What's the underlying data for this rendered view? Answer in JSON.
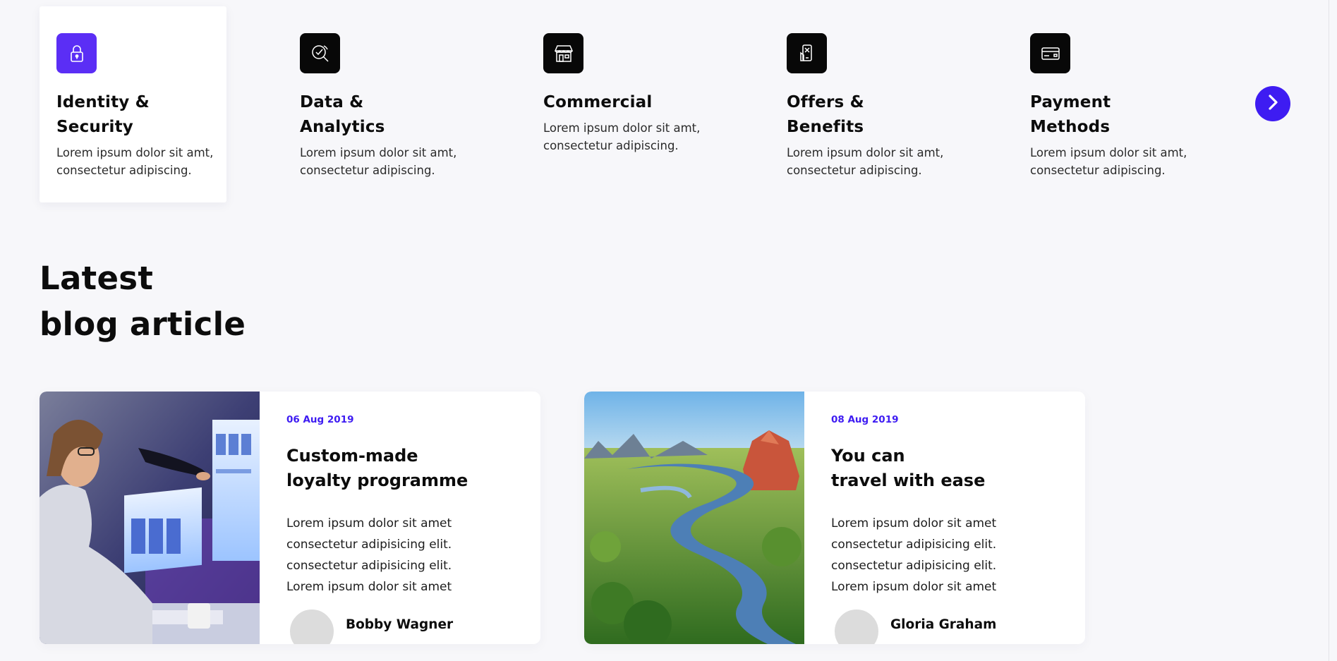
{
  "colors": {
    "accent": "#5b2ef5",
    "brand_blue": "#3e1cf2",
    "icon_bg": "#080808",
    "page_bg": "#f7f7fa"
  },
  "features": [
    {
      "title": "Identity &\nSecurity",
      "desc": "Lorem ipsum dolor sit amt, consectetur adipiscing.",
      "icon": "lock-icon",
      "active": true
    },
    {
      "title": "Data &\nAnalytics",
      "desc": "Lorem ipsum dolor sit amt, consectetur adipiscing.",
      "icon": "analytics-search-icon",
      "active": false
    },
    {
      "title": "Commercial",
      "desc": "Lorem ipsum dolor sit amt, consectetur adipiscing.",
      "icon": "store-icon",
      "active": false
    },
    {
      "title": "Offers &\nBenefits",
      "desc": "Lorem ipsum dolor sit amt, consectetur adipiscing.",
      "icon": "mobile-offer-icon",
      "active": false
    },
    {
      "title": "Payment\nMethods",
      "desc": "Lorem ipsum dolor sit amt, consectetur adipiscing.",
      "icon": "credit-card-icon",
      "active": false
    }
  ],
  "carousel": {
    "next_icon": "chevron-right-icon"
  },
  "blog": {
    "heading_line1": "Latest",
    "heading_line2": "blog article",
    "articles": [
      {
        "date": "06 Aug 2019",
        "title": "Custom-made\nloyalty programme",
        "text": "Lorem ipsum dolor sit amet\nconsectetur adipisicing elit.\nconsectetur adipisicing elit.\nLorem ipsum dolor sit amet",
        "author": "Bobby Wagner",
        "image": "woman-at-computer-photo"
      },
      {
        "date": "08 Aug 2019",
        "title": "You can\ntravel with ease",
        "text": "Lorem ipsum dolor sit amet\nconsectetur adipisicing elit.\nconsectetur adipisicing elit.\nLorem ipsum dolor sit amet",
        "author": "Gloria Graham",
        "image": "river-landscape-photo"
      }
    ]
  }
}
